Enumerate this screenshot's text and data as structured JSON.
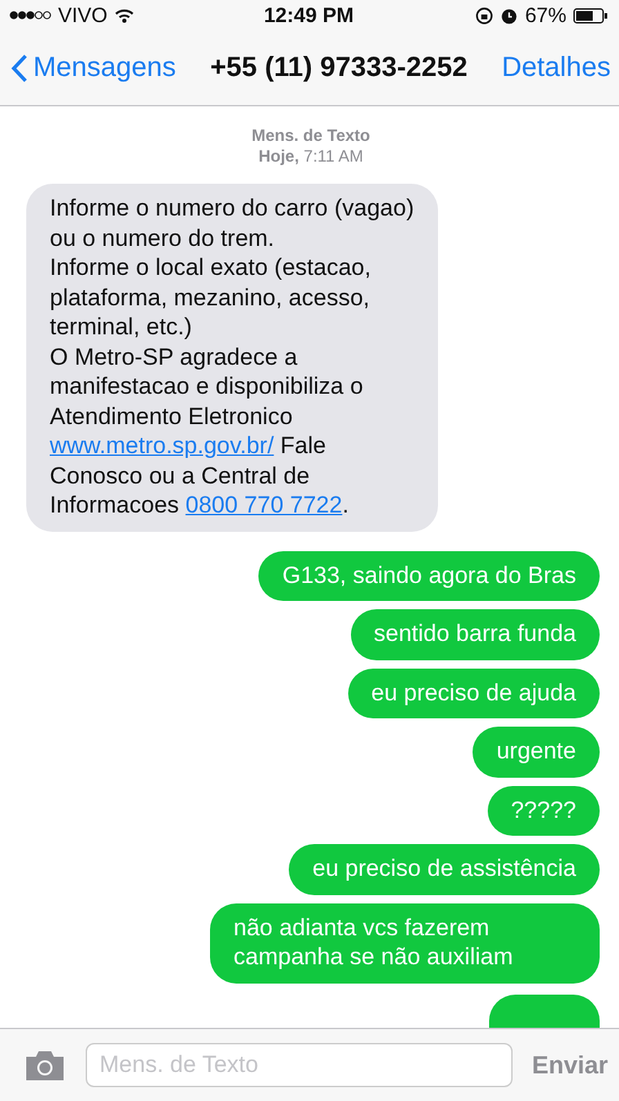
{
  "status_bar": {
    "carrier": "VIVO",
    "time": "12:49 PM",
    "battery": "67%"
  },
  "nav": {
    "back": "Mensagens",
    "title": "+55 (11) 97333-2252",
    "action": "Detalhes"
  },
  "thread_header": {
    "service": "Mens. de Texto",
    "date": "Hoje, ",
    "time": "7:11 AM"
  },
  "messages": [
    {
      "kind": "incoming",
      "parts": [
        {
          "kind": "text",
          "text": "Informe o numero do carro (vagao)\nou o numero do trem.\nInforme o local exato (estacao,\nplataforma, mezanino, acesso,\nterminal, etc.)\nO Metro-SP agradece a\nmanifestacao e disponibiliza o\nAtendimento Eletronico\n"
        },
        {
          "kind": "link",
          "text": "www.metro.sp.gov.br/"
        },
        {
          "kind": "text",
          "text": " Fale\nConosco ou a Central de\nInformacoes "
        },
        {
          "kind": "link",
          "text": "0800 770 7722"
        },
        {
          "kind": "text",
          "text": "."
        }
      ]
    },
    {
      "kind": "outgoing",
      "text": "G133, saindo agora do Bras"
    },
    {
      "kind": "outgoing",
      "text": "sentido barra funda"
    },
    {
      "kind": "outgoing",
      "text": "eu preciso de ajuda"
    },
    {
      "kind": "outgoing",
      "text": "urgente"
    },
    {
      "kind": "outgoing",
      "text": "?????"
    },
    {
      "kind": "outgoing",
      "text": "eu preciso de assistência"
    },
    {
      "kind": "outgoing",
      "text": "não adianta vcs fazerem campanha se não auxiliam"
    },
    {
      "kind": "cut_off"
    }
  ],
  "composer": {
    "placeholder": "Mens. de Texto",
    "send": "Enviar"
  }
}
